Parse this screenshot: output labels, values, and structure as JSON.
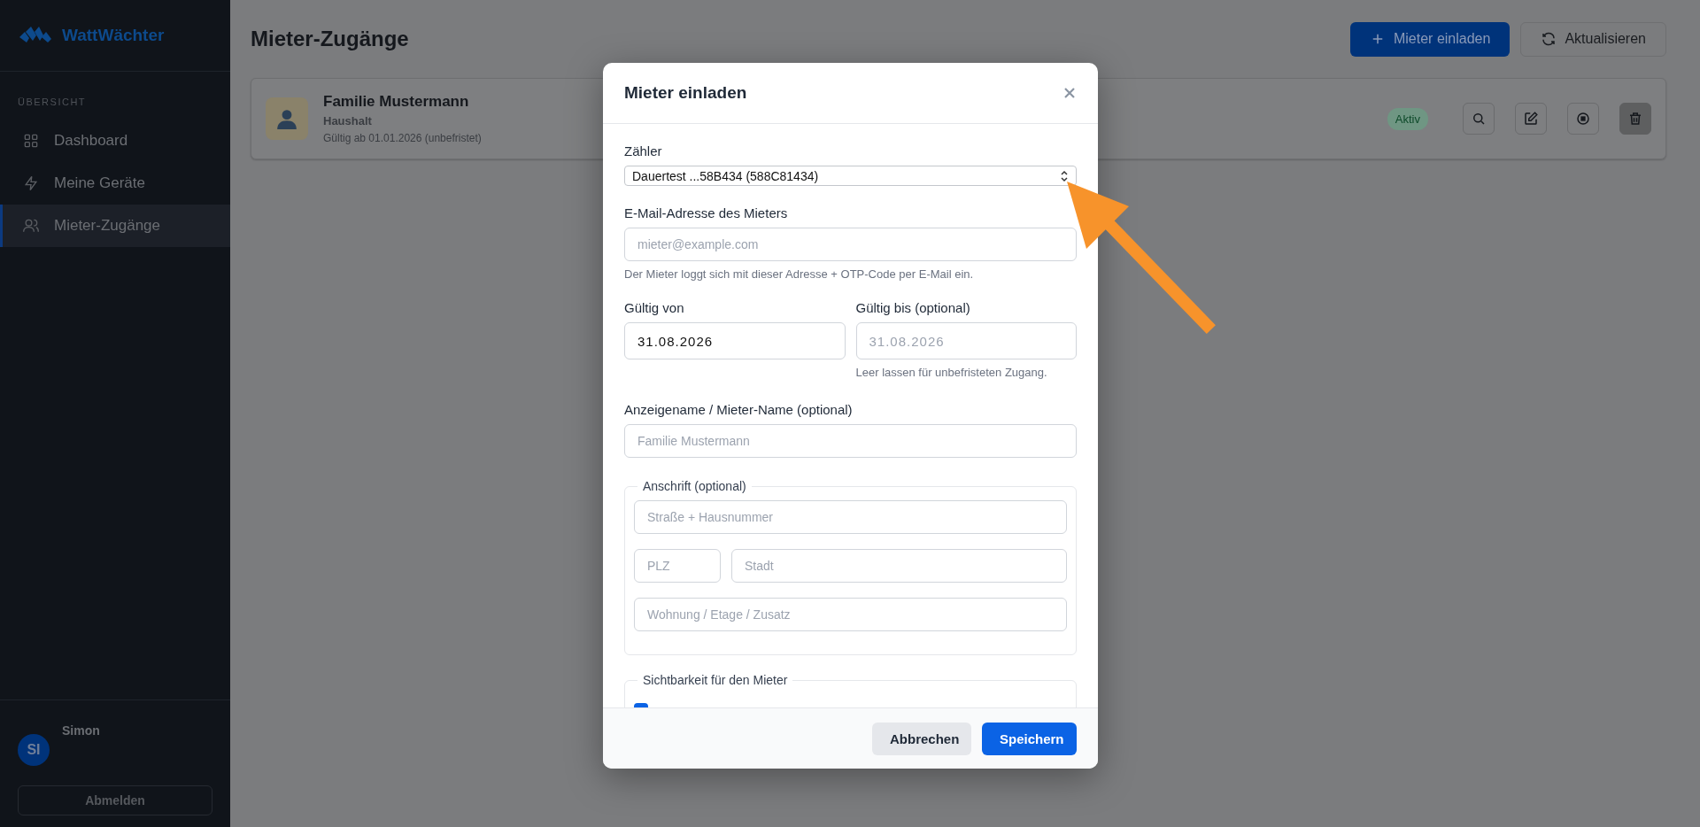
{
  "app": {
    "name": "WattWächter"
  },
  "sidebar": {
    "section": "ÜBERSICHT",
    "items": [
      {
        "label": "Dashboard",
        "selected": false
      },
      {
        "label": "Meine Geräte",
        "selected": false
      },
      {
        "label": "Mieter-Zugänge",
        "selected": true
      }
    ],
    "user": {
      "initials": "SI",
      "name": "Simon"
    },
    "logout": "Abmelden"
  },
  "page": {
    "title": "Mieter-Zugänge",
    "actions": [
      {
        "label": "Mieter einladen",
        "kind": "primary"
      },
      {
        "label": "Aktualisieren",
        "kind": "secondary"
      }
    ]
  },
  "tenants": [
    {
      "name": "Familie Mustermann",
      "type": "Haushalt",
      "validity": "Gültig ab 01.01.2026 (unbefristet)",
      "status": "Aktiv"
    }
  ],
  "dialog": {
    "title": "Mieter einladen",
    "meter": {
      "label": "Zähler",
      "value": "Dauertest ...58B434 (588C81434)"
    },
    "email": {
      "label": "E-Mail-Adresse des Mieters",
      "placeholder": "mieter@example.com",
      "hint": "Der Mieter loggt sich mit dieser Adresse + OTP-Code per E-Mail ein."
    },
    "valid_from": {
      "label": "Gültig von",
      "value": "31.08.2026"
    },
    "valid_to": {
      "label": "Gültig bis (optional)",
      "placeholder": "31.08.2026",
      "hint": "Leer lassen für unbefristeten Zugang."
    },
    "display_name": {
      "label": "Anzeigename / Mieter-Name (optional)",
      "placeholder": "Familie Mustermann"
    },
    "address": {
      "legend": "Anschrift (optional)",
      "fields": [
        {
          "kind": "street",
          "placeholder": "Straße + Hausnummer"
        },
        {
          "kind": "zip",
          "placeholder": "PLZ"
        },
        {
          "kind": "city",
          "placeholder": "Stadt"
        },
        {
          "kind": "extra",
          "placeholder": "Wohnung / Etage / Zusatz"
        }
      ]
    },
    "visibility": {
      "legend": "Sichtbarkeit für den Mieter",
      "options": [
        {
          "checked": true
        }
      ]
    },
    "buttons": [
      {
        "label": "Abbrechen",
        "kind": "secondary"
      },
      {
        "label": "Speichern",
        "kind": "primary"
      }
    ]
  }
}
